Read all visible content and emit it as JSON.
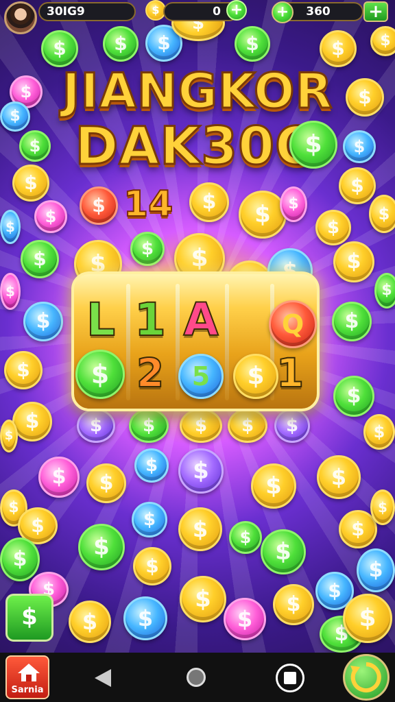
{
  "header": {
    "left_balance": "30IG9",
    "mid_balance": "0",
    "right_balance": "360",
    "plus_symbol": "+"
  },
  "title": {
    "line1": "JIANGKOR",
    "line2": "DAK30O"
  },
  "level": "14",
  "reels": {
    "row1": [
      "L",
      "1",
      "A",
      "Q"
    ],
    "row2": [
      "$",
      "2",
      "5",
      "$",
      "1"
    ]
  },
  "coin_symbol": "$",
  "bottom": {
    "home_label": "Sarnia"
  },
  "colors": {
    "gold": "#ffcf2a",
    "green": "#4fe03a",
    "blue": "#46b6ff",
    "pink": "#ff5fd8",
    "red": "#ff5a3a",
    "purple": "#a36bff"
  }
}
